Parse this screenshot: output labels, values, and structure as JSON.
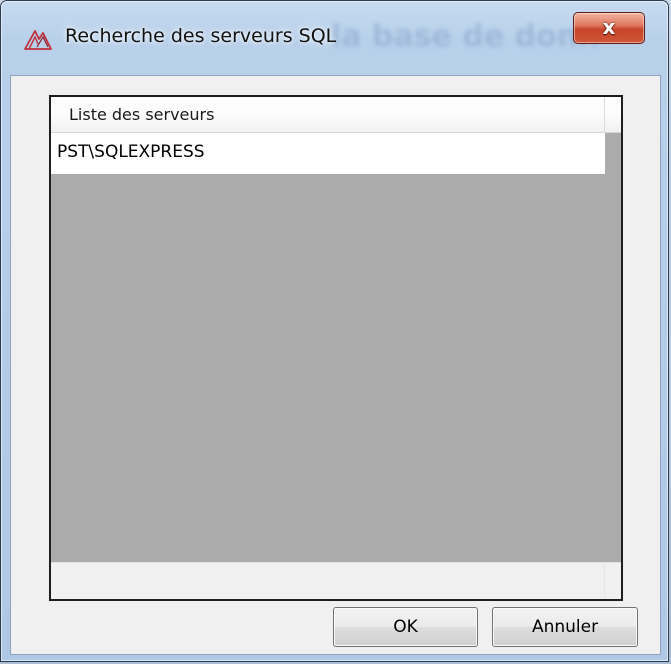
{
  "window": {
    "title": "Recherche des serveurs SQL",
    "background_title": "la base de donn",
    "close_label": "x",
    "icon": "app-logo-icon"
  },
  "server_list": {
    "column_header": "Liste des serveurs",
    "items": [
      "PST\\SQLEXPRESS"
    ]
  },
  "buttons": {
    "ok_label": "OK",
    "cancel_label": "Annuler"
  },
  "colors": {
    "list_background": "#ababab",
    "close_button": "#c7432a",
    "dialog_background": "#f0f0f0"
  }
}
